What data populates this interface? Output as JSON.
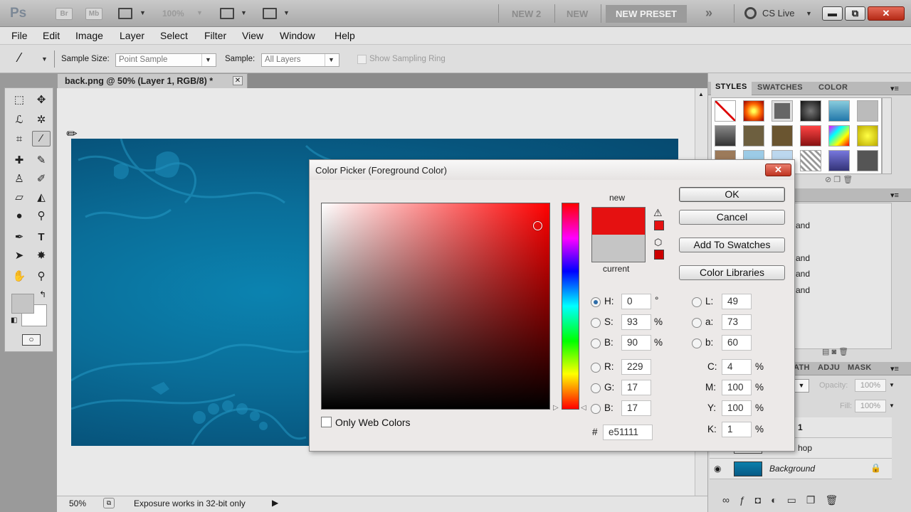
{
  "app": {
    "logo": "Ps",
    "bridge_label": "Br",
    "minibridge_label": "Mb",
    "zoom": "100%",
    "workspaces": [
      "NEW 2",
      "NEW",
      "NEW PRESET"
    ],
    "more": "»",
    "cs_live": "CS Live",
    "window_buttons": {
      "minimize": "▬",
      "restore": "⧉",
      "close": "✕"
    }
  },
  "menu": [
    "File",
    "Edit",
    "Image",
    "Layer",
    "Select",
    "Filter",
    "View",
    "Window",
    "Help"
  ],
  "options": {
    "sample_size_label": "Sample Size:",
    "sample_size_value": "Point Sample",
    "sample_label": "Sample:",
    "sample_value": "All Layers",
    "show_ring_label": "Show Sampling Ring"
  },
  "document": {
    "tab_title": "back.png @ 50% (Layer 1, RGB/8) *",
    "close": "✕",
    "zoom": "50%",
    "status": "Exposure works in 32-bit only"
  },
  "panels": {
    "top_tabs": [
      "STYLES",
      "SWATCHES",
      "COLOR"
    ],
    "adj_tabs": [
      "ATH",
      "ADJU",
      "MASK"
    ],
    "opacity_label": "Opacity:",
    "opacity": "100%",
    "fill_label": "Fill:",
    "fill": "100%",
    "channel_rows": [
      "and",
      "and",
      "and",
      "and"
    ],
    "layers": [
      {
        "name": "1",
        "italic": false
      },
      {
        "name": "hop",
        "italic": false
      },
      {
        "name": "Background",
        "italic": true
      }
    ]
  },
  "dialog": {
    "title": "Color Picker (Foreground Color)",
    "close": "✕",
    "new_label": "new",
    "current_label": "current",
    "new_color": "#e51111",
    "current_color": "#c5c5c5",
    "buttons": {
      "ok": "OK",
      "cancel": "Cancel",
      "add_swatches": "Add To Swatches",
      "libraries": "Color Libraries"
    },
    "only_web": "Only Web Colors",
    "hsb": [
      {
        "label": "H:",
        "value": "0",
        "unit": "°"
      },
      {
        "label": "S:",
        "value": "93",
        "unit": "%"
      },
      {
        "label": "B:",
        "value": "90",
        "unit": "%"
      }
    ],
    "rgb": [
      {
        "label": "R:",
        "value": "229"
      },
      {
        "label": "G:",
        "value": "17"
      },
      {
        "label": "B:",
        "value": "17"
      }
    ],
    "lab": [
      {
        "label": "L:",
        "value": "49"
      },
      {
        "label": "a:",
        "value": "73"
      },
      {
        "label": "b:",
        "value": "60"
      }
    ],
    "cmyk": [
      {
        "label": "C:",
        "value": "4",
        "unit": "%"
      },
      {
        "label": "M:",
        "value": "100",
        "unit": "%"
      },
      {
        "label": "Y:",
        "value": "100",
        "unit": "%"
      },
      {
        "label": "K:",
        "value": "1",
        "unit": "%"
      }
    ],
    "hex_label": "#",
    "hex": "e51111"
  }
}
